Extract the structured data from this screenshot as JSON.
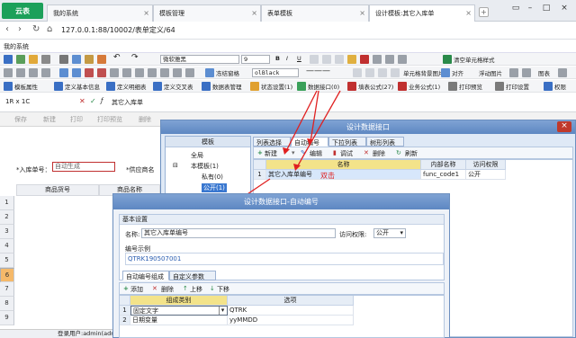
{
  "browser": {
    "logo": "云表",
    "tabs": [
      "我的系统",
      "模板管理",
      "表单模板",
      "设计模板:其它入库单"
    ],
    "url": "127.0.0.1:88/10002/表单定义/64",
    "bookmark": "我的系统"
  },
  "toolbar": {
    "font": "微软雅黑",
    "size": "9",
    "freeze": "冻结窗格",
    "color_val": "olBlack",
    "clear_fmt": "清空单元格样式",
    "cell_img": "单元格背景图片",
    "align": "对齐",
    "float_pic": "浮动图片",
    "chart": "图表",
    "row3": [
      "模板属性",
      "定义基本信息",
      "定义明细表",
      "定义交叉表",
      "数据表管理",
      "状态设置(1)",
      "数据接口(0)",
      "填表公式(27)",
      "业务公式(1)",
      "打印预览",
      "打印设置",
      "权限"
    ]
  },
  "formula": {
    "cellref": "1R x 1C",
    "value": "其它入库单"
  },
  "form_toolbar": [
    "保存",
    "新建",
    "打印",
    "打印预览",
    "删除"
  ],
  "form": {
    "label1": "*入库单号：",
    "value1": "自动生成",
    "label2": "*供应商名"
  },
  "sheet": {
    "columns": [
      "商品货号",
      "商品名称"
    ],
    "rows": [
      "1",
      "2",
      "3",
      "4",
      "5",
      "6",
      "7",
      "8",
      "9"
    ]
  },
  "status": "登录用户:admin(admin)",
  "dialog1": {
    "title": "设计数据接口",
    "tree_header": "模板",
    "tree": [
      "全局",
      "本模板(1)",
      "私有(0)",
      "公开(1)"
    ],
    "tabs": [
      "列表选择",
      "自动编号",
      "下拉列表",
      "树形列表"
    ],
    "toolbar": [
      "新建",
      "编辑",
      "调试",
      "删除",
      "刷新"
    ],
    "headers": [
      "",
      "名称",
      "内部名称",
      "访问权限"
    ],
    "rows": [
      {
        "num": "1",
        "name": "其它入库单编号",
        "internal": "func_code1",
        "access": "公开"
      }
    ],
    "annotation": "双击"
  },
  "dialog2": {
    "title": "设计数据接口-自动编号",
    "basic_header": "基本设置",
    "name_label": "名称:",
    "name_value": "其它入库单编号",
    "access_label": "访问权限:",
    "access_value": "公开",
    "example_label": "编号示例",
    "example_value": "QTRK190507001",
    "subtabs": [
      "自动编号组成",
      "自定义参数"
    ],
    "toolbar": [
      "添加",
      "删除",
      "上移",
      "下移"
    ],
    "headers": [
      "",
      "组成类别",
      "选项"
    ],
    "rows": [
      {
        "num": "1",
        "type": "固定文字",
        "option": "QTRK"
      },
      {
        "num": "2",
        "type": "日期变量",
        "option": "yyMMDD"
      }
    ]
  }
}
